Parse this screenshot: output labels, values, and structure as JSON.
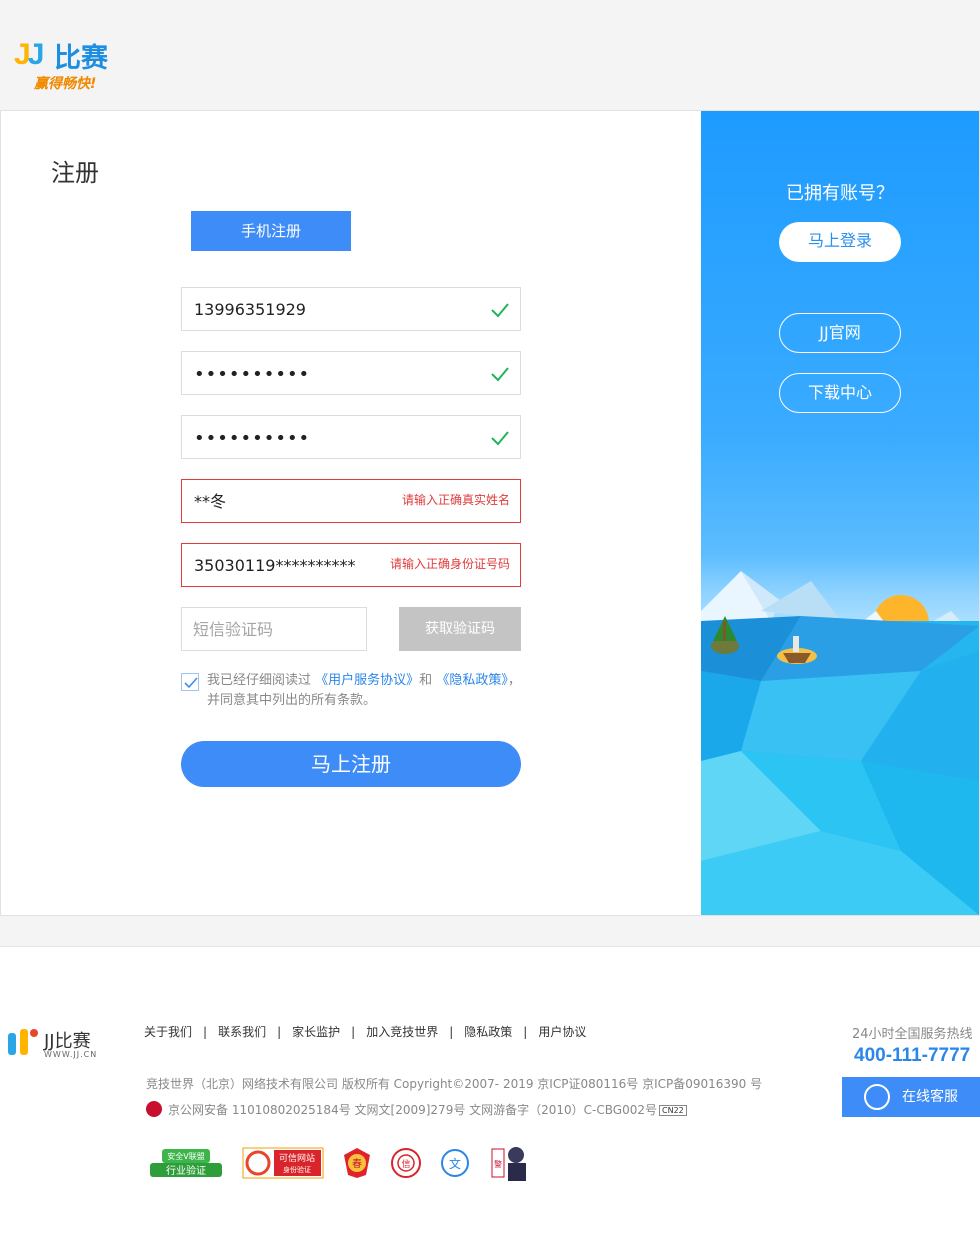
{
  "header": {
    "logo_mark": "JJ",
    "logo_brand": "比赛",
    "logo_slogan": "赢得畅快!"
  },
  "form": {
    "title": "注册",
    "tab_label": "手机注册",
    "phone_value": "13996351929",
    "password_value": "••••••••••",
    "confirm_password_value": "••••••••••",
    "name_value": "**冬",
    "name_error": "请输入正确真实姓名",
    "id_value": "35030119**********",
    "id_error": "请输入正确身份证号码",
    "sms_placeholder": "短信验证码",
    "sms_button": "获取验证码",
    "agree_prefix": "我已经仔细阅读过",
    "agree_link1": "《用户服务协议》",
    "agree_and": "和",
    "agree_link2": "《隐私政策》",
    "agree_suffix": "，并同意其中列出的所有条款。",
    "agree_checked": true,
    "submit_label": "马上注册"
  },
  "side": {
    "have_account": "已拥有账号？",
    "login_button": "马上登录",
    "official_button": "JJ官网",
    "download_button": "下载中心"
  },
  "footer": {
    "logo_brand": "JJ比赛",
    "logo_url": "WWW.JJ.CN",
    "links": [
      "关于我们",
      "联系我们",
      "家长监护",
      "加入竞技世界",
      "隐私政策",
      "用户协议"
    ],
    "copyright": "竞技世界（北京）网络技术有限公司 版权所有 Copyright©2007- 2019 京ICP证080116号 京ICP备09016390 号",
    "icp": "京公网安备 11010802025184号 文网文[2009]279号 文网游备字（2010）C-CBG002号",
    "cn22": "CN22",
    "badges": [
      {
        "top": "安全V联盟",
        "bottom": "行业验证"
      },
      {
        "top": "可信网站",
        "bottom": "身份验证"
      },
      {
        "text": "春"
      },
      {
        "text": "信"
      },
      {
        "text": "文"
      },
      {
        "text": "警"
      }
    ],
    "hotline_label": "24小时全国服务热线",
    "hotline": "400-111-7777",
    "service_label": "在线客服"
  },
  "colors": {
    "accent": "#3e8cf7",
    "error": "#e03a3a",
    "success": "#22b35a",
    "disabled": "#c4c4c4"
  }
}
